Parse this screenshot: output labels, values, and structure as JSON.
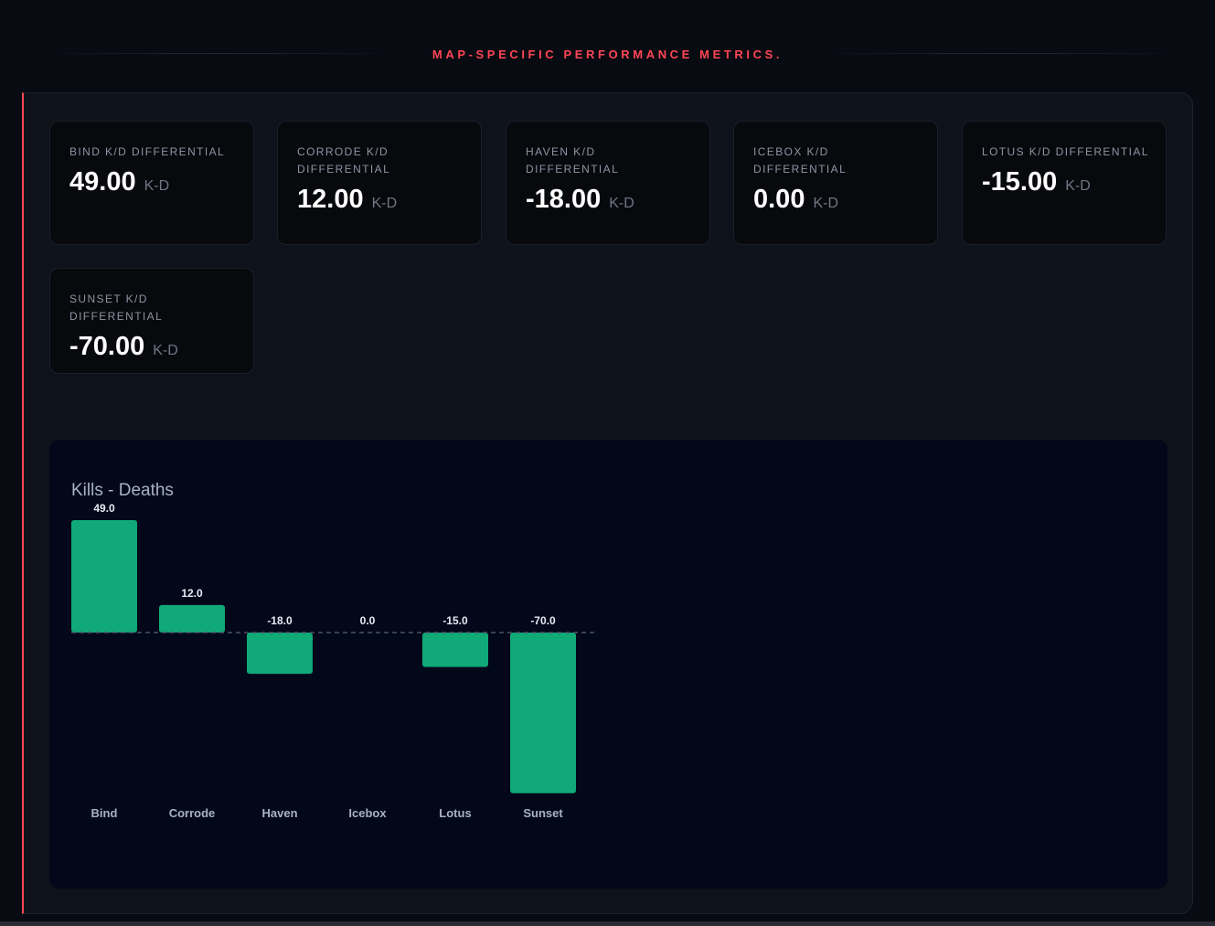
{
  "header": {
    "title": "MAP-SPECIFIC PERFORMANCE METRICS."
  },
  "colors": {
    "accent": "#ff4655",
    "bar": "#10a977",
    "panel": "#0e131b",
    "chart_bg": "#03071a"
  },
  "cards": [
    {
      "label": "BIND K/D DIFFERENTIAL",
      "value": "49.00",
      "unit": "K-D"
    },
    {
      "label": "CORRODE K/D DIFFERENTIAL",
      "value": "12.00",
      "unit": "K-D"
    },
    {
      "label": "HAVEN K/D DIFFERENTIAL",
      "value": "-18.00",
      "unit": "K-D"
    },
    {
      "label": "ICEBOX K/D DIFFERENTIAL",
      "value": "0.00",
      "unit": "K-D"
    },
    {
      "label": "LOTUS K/D DIFFERENTIAL",
      "value": "-15.00",
      "unit": "K-D"
    },
    {
      "label": "SUNSET K/D DIFFERENTIAL",
      "value": "-70.00",
      "unit": "K-D"
    }
  ],
  "chart_data": {
    "type": "bar",
    "title": "Kills - Deaths",
    "categories": [
      "Bind",
      "Corrode",
      "Haven",
      "Icebox",
      "Lotus",
      "Sunset"
    ],
    "values": [
      49.0,
      12.0,
      -18.0,
      0.0,
      -15.0,
      -70.0
    ],
    "value_labels": [
      "49.0",
      "12.0",
      "-18.0",
      "0.0",
      "-15.0",
      "-70.0"
    ],
    "baseline": 0,
    "baseline_style": "dashed",
    "grid": false,
    "legend": "none"
  }
}
